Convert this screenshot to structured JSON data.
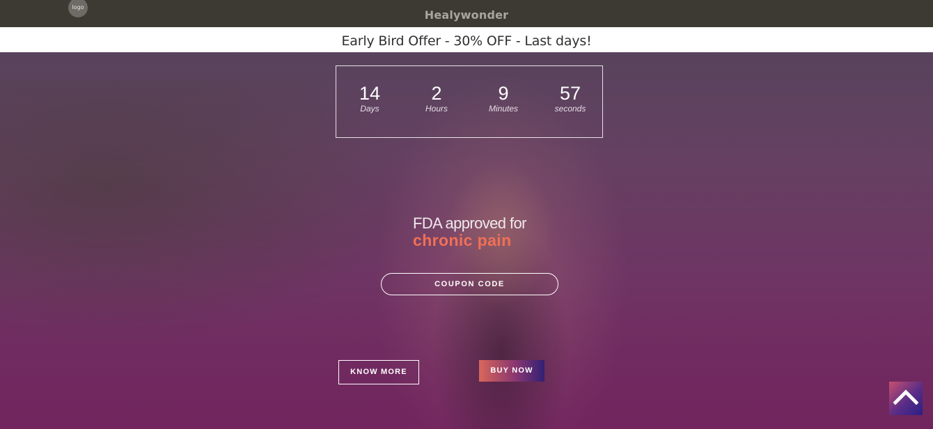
{
  "header": {
    "logo_text": "logo",
    "brand": "Healywonder"
  },
  "offer": {
    "text": "Early Bird Offer - 30% OFF - Last days!"
  },
  "countdown": [
    {
      "value": "14",
      "label": "Days"
    },
    {
      "value": "2",
      "label": "Hours"
    },
    {
      "value": "9",
      "label": "Minutes"
    },
    {
      "value": "57",
      "label": "seconds"
    }
  ],
  "hero": {
    "headline_line1": "FDA approved for",
    "headline_line2": "chronic pain",
    "coupon_label": "COUPON CODE",
    "know_more_label": "KNOW MORE",
    "buy_now_label": "BUY NOW"
  },
  "colors": {
    "accent": "#f07055",
    "topbar": "#3d3a34"
  },
  "icons": {
    "scroll_top": "chevron-up-icon"
  }
}
